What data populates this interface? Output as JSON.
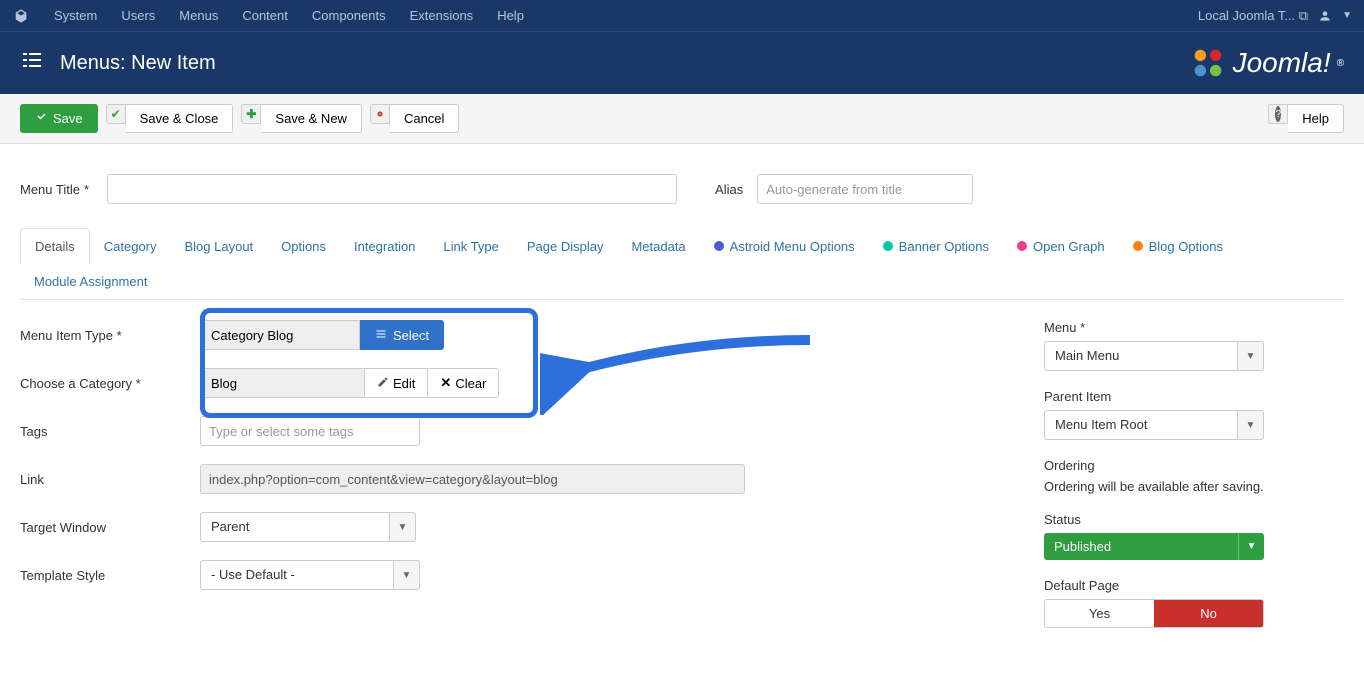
{
  "topbar": {
    "menus": [
      "System",
      "Users",
      "Menus",
      "Content",
      "Components",
      "Extensions",
      "Help"
    ],
    "site": "Local Joomla T..."
  },
  "header": {
    "title": "Menus: New Item",
    "brand": "Joomla!"
  },
  "toolbar": {
    "save": "Save",
    "save_close": "Save & Close",
    "save_new": "Save & New",
    "cancel": "Cancel",
    "help": "Help"
  },
  "title_row": {
    "menu_title_lbl": "Menu Title",
    "alias_lbl": "Alias",
    "alias_placeholder": "Auto-generate from title"
  },
  "tabs": [
    {
      "label": "Details",
      "active": true
    },
    {
      "label": "Category"
    },
    {
      "label": "Blog Layout"
    },
    {
      "label": "Options"
    },
    {
      "label": "Integration"
    },
    {
      "label": "Link Type"
    },
    {
      "label": "Page Display"
    },
    {
      "label": "Metadata"
    },
    {
      "label": "Astroid Menu Options",
      "dot": "#4f5bd5"
    },
    {
      "label": "Banner Options",
      "dot": "#00c9a7"
    },
    {
      "label": "Open Graph",
      "dot": "#e83e8c"
    },
    {
      "label": "Blog Options",
      "dot": "#fd7e14"
    },
    {
      "label": "Module Assignment"
    }
  ],
  "fields": {
    "menu_item_type_lbl": "Menu Item Type",
    "menu_item_type_val": "Category Blog",
    "select_btn": "Select",
    "category_lbl": "Choose a Category",
    "category_val": "Blog",
    "edit_btn": "Edit",
    "clear_btn": "Clear",
    "tags_lbl": "Tags",
    "tags_placeholder": "Type or select some tags",
    "link_lbl": "Link",
    "link_val": "index.php?option=com_content&view=category&layout=blog",
    "target_lbl": "Target Window",
    "target_val": "Parent",
    "template_lbl": "Template Style",
    "template_val": "- Use Default -"
  },
  "side": {
    "menu_lbl": "Menu",
    "menu_val": "Main Menu",
    "parent_lbl": "Parent Item",
    "parent_val": "Menu Item Root",
    "ordering_lbl": "Ordering",
    "ordering_note": "Ordering will be available after saving.",
    "status_lbl": "Status",
    "status_val": "Published",
    "default_lbl": "Default Page",
    "yes": "Yes",
    "no": "No"
  }
}
